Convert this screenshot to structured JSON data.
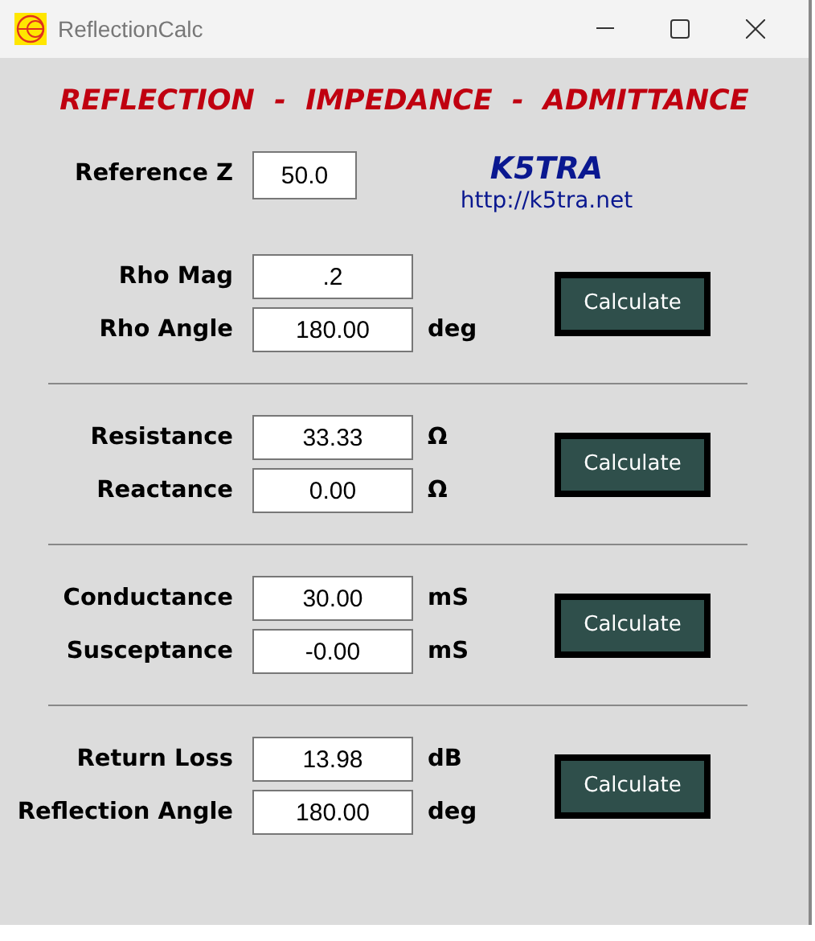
{
  "window": {
    "title": "ReflectionCalc"
  },
  "heading": "REFLECTION  -  IMPEDANCE  -  ADMITTANCE",
  "reference": {
    "label": "Reference Z",
    "value": "50.0"
  },
  "brand": {
    "name": "K5TRA",
    "url": "http://k5tra.net"
  },
  "sections": [
    {
      "rows": [
        {
          "label": "Rho Mag",
          "value": ".2"
        },
        {
          "label": "Rho Angle",
          "value": "180.00",
          "unit": "deg"
        }
      ],
      "button": "Calculate"
    },
    {
      "rows": [
        {
          "label": "Resistance",
          "value": "33.33",
          "unit": "Ω"
        },
        {
          "label": "Reactance",
          "value": "0.00",
          "unit": "Ω"
        }
      ],
      "button": "Calculate"
    },
    {
      "rows": [
        {
          "label": "Conductance",
          "value": "30.00",
          "unit": "mS"
        },
        {
          "label": "Susceptance",
          "value": "-0.00",
          "unit": "mS"
        }
      ],
      "button": "Calculate"
    },
    {
      "rows": [
        {
          "label": "Return Loss",
          "value": "13.98",
          "unit": "dB"
        },
        {
          "label": "Reflection Angle",
          "value": "180.00",
          "unit": "deg"
        }
      ],
      "button": "Calculate"
    }
  ]
}
